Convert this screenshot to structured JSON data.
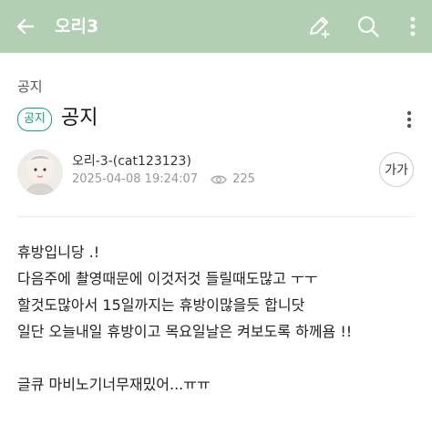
{
  "appbar": {
    "title": "오리3",
    "background": "#b2cfb3",
    "icons": [
      "back-arrow-icon",
      "edit-icon",
      "search-icon",
      "more-vertical-icon"
    ]
  },
  "board": {
    "name": "공지"
  },
  "post": {
    "badge": "공지",
    "badge_color": "#1aa06e",
    "title": "공지",
    "author": "오리-3-(cat123123)",
    "datetime": "2025-04-08 19:24:07",
    "views": "225",
    "font_size_button": "가가",
    "body_lines": [
      "휴방입니당 .!",
      "다음주에 촬영때문에 이것저것 들릴때도많고 ㅜㅜ",
      "할것도많아서 15일까지는 휴방이많을듯 합니닷",
      "일단 오늘내일 휴방이고 목요일날은 켜보도록 하께욤 !!",
      "",
      "글큐 마비노기너무재밌어...ㅠㅠ"
    ]
  }
}
